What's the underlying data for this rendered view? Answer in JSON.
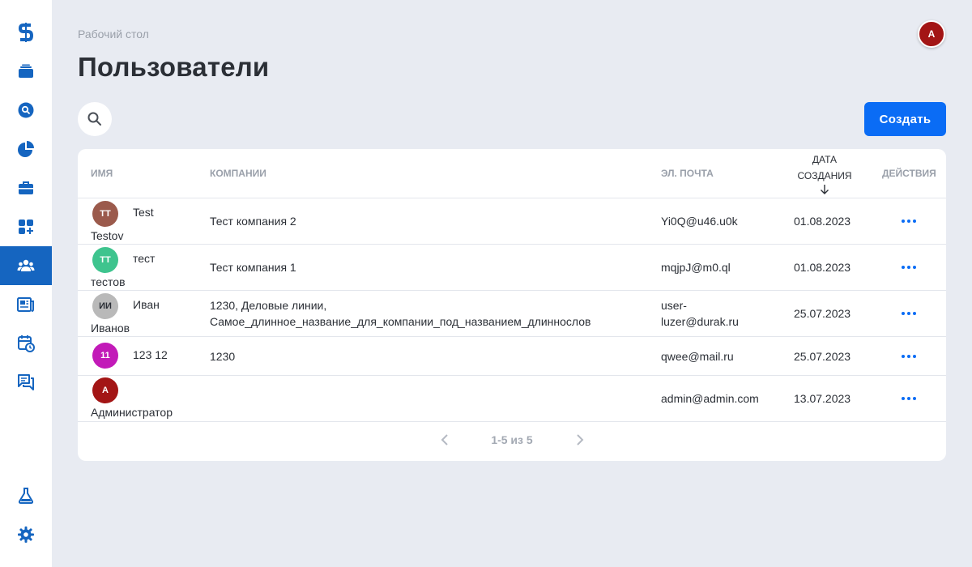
{
  "breadcrumb": "Рабочий стол",
  "title": "Пользователи",
  "current_user_initials": "А",
  "create_label": "Создать",
  "colors": {
    "accent": "#0a6cf5",
    "sidebar_active": "#1565c0"
  },
  "sidebar": {
    "items": [
      "logo-icon",
      "stack-icon",
      "search-circle-icon",
      "pie-chart-icon",
      "briefcase-icon",
      "apps-add-icon",
      "users-icon",
      "news-icon",
      "calendar-clock-icon",
      "chat-icon",
      "flask-icon",
      "gear-icon"
    ],
    "active": "users-icon"
  },
  "table": {
    "headers": {
      "name": "ИМЯ",
      "companies": "КОМПАНИИ",
      "email": "ЭЛ. ПОЧТА",
      "created_1": "ДАТА",
      "created_2": "СОЗДАНИЯ",
      "actions": "ДЕЙСТВИЯ"
    },
    "rows": [
      {
        "initials": "ТТ",
        "avatar_color": "#9b5a4c",
        "first": "Test",
        "last": "Testov",
        "company_1": "Тест компания 2",
        "company_2": "",
        "email_1": "Yi0Q@u46.u0k",
        "email_2": "",
        "date": "01.08.2023"
      },
      {
        "initials": "ТТ",
        "avatar_color": "#3ec48e",
        "first": "тест",
        "last": "тестов",
        "company_1": "Тест компания 1",
        "company_2": "",
        "email_1": "mqjpJ@m0.ql",
        "email_2": "",
        "date": "01.08.2023"
      },
      {
        "initials": "ИИ",
        "avatar_color": "#b9b9b9",
        "first": "Иван",
        "last": "Иванов",
        "company_1": "1230, Деловые линии,",
        "company_2": "Самое_длинное_название_для_компании_под_названием_длиннослов",
        "email_1": "user-",
        "email_2": "luzer@durak.ru",
        "date": "25.07.2023"
      },
      {
        "initials": "11",
        "avatar_color": "#c21ab8",
        "first": "123 12",
        "last": "",
        "company_1": "1230",
        "company_2": "",
        "email_1": "qwee@mail.ru",
        "email_2": "",
        "date": "25.07.2023"
      },
      {
        "initials": "А",
        "avatar_color": "#a31515",
        "first": "",
        "last": "Администратор",
        "company_1": "",
        "company_2": "",
        "email_1": "admin@admin.com",
        "email_2": "",
        "date": "13.07.2023"
      }
    ]
  },
  "pagination": {
    "text": "1-5 из 5"
  }
}
